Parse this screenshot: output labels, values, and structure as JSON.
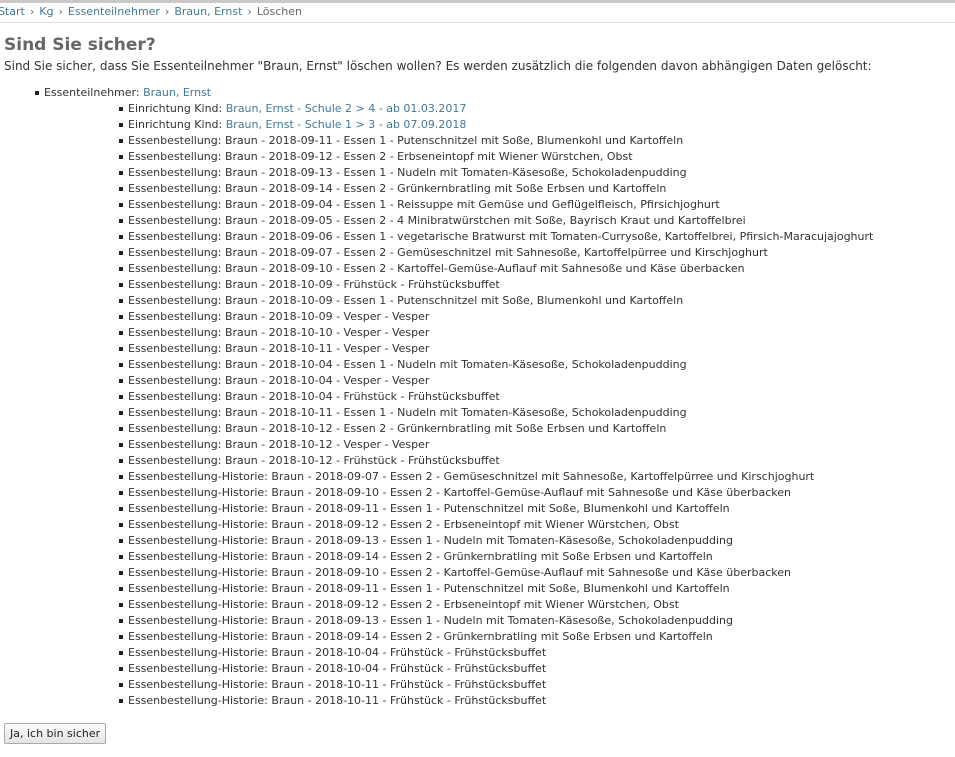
{
  "breadcrumbs": {
    "items": [
      "Start",
      "Kg",
      "Essenteilnehmer",
      "Braun, Ernst"
    ],
    "separator": "›",
    "current": "Löschen"
  },
  "heading": "Sind Sie sicher?",
  "intro": "Sind Sie sicher, dass Sie Essenteilnehmer \"Braun, Ernst\" löschen wollen? Es werden zusätzlich die folgenden davon abhängigen Daten gelöscht:",
  "tree": {
    "root_label": "Essenteilnehmer:",
    "root_link": "Braun, Ernst",
    "linked_items": [
      {
        "label": "Einrichtung Kind:",
        "link": "Braun, Ernst - Schule 2 > 4 - ab 01.03.2017"
      },
      {
        "label": "Einrichtung Kind:",
        "link": "Braun, Ernst - Schule 1 > 3 - ab 07.09.2018"
      }
    ],
    "items": [
      "Essenbestellung: Braun - 2018-09-11 - Essen 1 - Putenschnitzel mit Soße, Blumenkohl und Kartoffeln",
      "Essenbestellung: Braun - 2018-09-12 - Essen 2 - Erbseneintopf mit Wiener Würstchen, Obst",
      "Essenbestellung: Braun - 2018-09-13 - Essen 1 - Nudeln mit Tomaten-Käsesoße, Schokoladenpudding",
      "Essenbestellung: Braun - 2018-09-14 - Essen 2 - Grünkernbratling mit Soße Erbsen und Kartoffeln",
      "Essenbestellung: Braun - 2018-09-04 - Essen 1 - Reissuppe mit Gemüse und Geflügelfleisch, Pfirsichjoghurt",
      "Essenbestellung: Braun - 2018-09-05 - Essen 2 - 4 Minibratwürstchen mit Soße, Bayrisch Kraut und Kartoffelbrei",
      "Essenbestellung: Braun - 2018-09-06 - Essen 1 - vegetarische Bratwurst mit Tomaten-Currysoße, Kartoffelbrei, Pfirsich-Maracujajoghurt",
      "Essenbestellung: Braun - 2018-09-07 - Essen 2 - Gemüseschnitzel mit Sahnesoße, Kartoffelpürree und Kirschjoghurt",
      "Essenbestellung: Braun - 2018-09-10 - Essen 2 - Kartoffel-Gemüse-Auflauf mit Sahnesoße und Käse überbacken",
      "Essenbestellung: Braun - 2018-10-09 - Frühstück - Frühstücksbuffet",
      "Essenbestellung: Braun - 2018-10-09 - Essen 1 - Putenschnitzel mit Soße, Blumenkohl und Kartoffeln",
      "Essenbestellung: Braun - 2018-10-09 - Vesper - Vesper",
      "Essenbestellung: Braun - 2018-10-10 - Vesper - Vesper",
      "Essenbestellung: Braun - 2018-10-11 - Vesper - Vesper",
      "Essenbestellung: Braun - 2018-10-04 - Essen 1 - Nudeln mit Tomaten-Käsesoße, Schokoladenpudding",
      "Essenbestellung: Braun - 2018-10-04 - Vesper - Vesper",
      "Essenbestellung: Braun - 2018-10-04 - Frühstück - Frühstücksbuffet",
      "Essenbestellung: Braun - 2018-10-11 - Essen 1 - Nudeln mit Tomaten-Käsesoße, Schokoladenpudding",
      "Essenbestellung: Braun - 2018-10-12 - Essen 2 - Grünkernbratling mit Soße Erbsen und Kartoffeln",
      "Essenbestellung: Braun - 2018-10-12 - Vesper - Vesper",
      "Essenbestellung: Braun - 2018-10-12 - Frühstück - Frühstücksbuffet",
      "Essenbestellung-Historie: Braun - 2018-09-07 - Essen 2 - Gemüseschnitzel mit Sahnesoße, Kartoffelpürree und Kirschjoghurt",
      "Essenbestellung-Historie: Braun - 2018-09-10 - Essen 2 - Kartoffel-Gemüse-Auflauf mit Sahnesoße und Käse überbacken",
      "Essenbestellung-Historie: Braun - 2018-09-11 - Essen 1 - Putenschnitzel mit Soße, Blumenkohl und Kartoffeln",
      "Essenbestellung-Historie: Braun - 2018-09-12 - Essen 2 - Erbseneintopf mit Wiener Würstchen, Obst",
      "Essenbestellung-Historie: Braun - 2018-09-13 - Essen 1 - Nudeln mit Tomaten-Käsesoße, Schokoladenpudding",
      "Essenbestellung-Historie: Braun - 2018-09-14 - Essen 2 - Grünkernbratling mit Soße Erbsen und Kartoffeln",
      "Essenbestellung-Historie: Braun - 2018-09-10 - Essen 2 - Kartoffel-Gemüse-Auflauf mit Sahnesoße und Käse überbacken",
      "Essenbestellung-Historie: Braun - 2018-09-11 - Essen 1 - Putenschnitzel mit Soße, Blumenkohl und Kartoffeln",
      "Essenbestellung-Historie: Braun - 2018-09-12 - Essen 2 - Erbseneintopf mit Wiener Würstchen, Obst",
      "Essenbestellung-Historie: Braun - 2018-09-13 - Essen 1 - Nudeln mit Tomaten-Käsesoße, Schokoladenpudding",
      "Essenbestellung-Historie: Braun - 2018-09-14 - Essen 2 - Grünkernbratling mit Soße Erbsen und Kartoffeln",
      "Essenbestellung-Historie: Braun - 2018-10-04 - Frühstück - Frühstücksbuffet",
      "Essenbestellung-Historie: Braun - 2018-10-04 - Frühstück - Frühstücksbuffet",
      "Essenbestellung-Historie: Braun - 2018-10-11 - Frühstück - Frühstücksbuffet",
      "Essenbestellung-Historie: Braun - 2018-10-11 - Frühstück - Frühstücksbuffet"
    ]
  },
  "confirm_button": "Ja, ich bin sicher",
  "colors": {
    "link": "#447799",
    "heading": "#666666",
    "text": "#333333"
  }
}
